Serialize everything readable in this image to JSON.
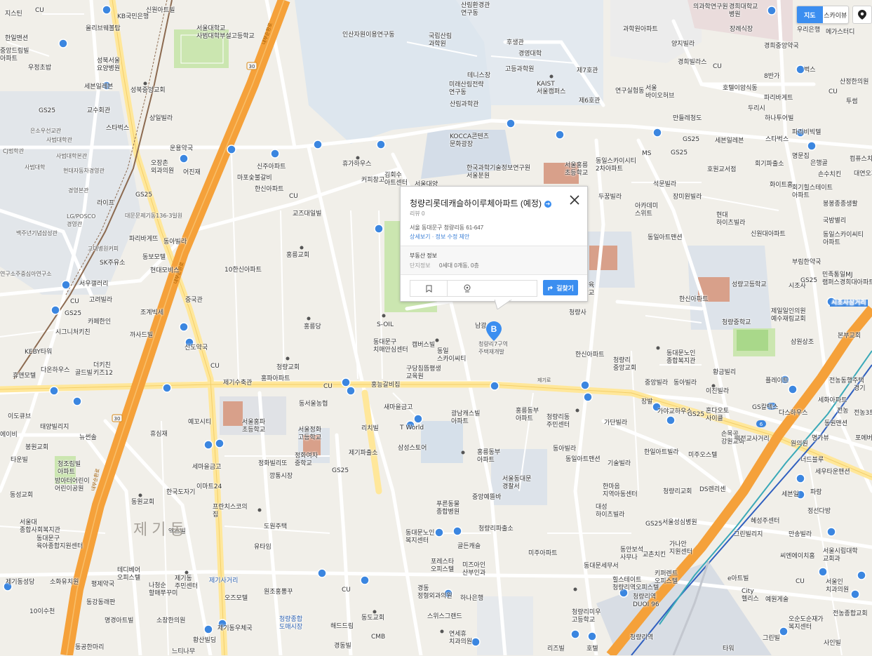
{
  "map_controls": {
    "map_type_map": "지도",
    "map_type_skyview": "스카이뷰",
    "location_icon": "location-icon"
  },
  "popup": {
    "title": "청량리롯데캐슬하이루체아파트 (예정)",
    "review": "리뷰 0",
    "address": "서울 동대문구 청량리동 61-647",
    "link_detail": "상세보기",
    "link_sep": "·",
    "link_edit": "정보 수정 제안",
    "section_title": "부동산 정보",
    "complex_key": "단지정보",
    "complex_value": "0세대 0개동, 0층",
    "route_label": "길찾기",
    "bookmark_icon": "bookmark-icon",
    "place_icon": "map-pin-icon",
    "close_icon": "close-icon",
    "route_icon": "direction-icon"
  },
  "marker": {
    "label": "B",
    "color": "#3b8ef0"
  },
  "map_labels": {
    "district_big": "제기동",
    "road_naebu": "내부순환로",
    "road_30": "30",
    "road_6": "6",
    "road_jegiro": "제기로",
    "jegi_intersection": "제기사거리",
    "jegi_station_label": "제기동역",
    "kaist": "KAIST\n서울캠퍼스",
    "korea_univ_hospital": "경희대학교\n병원",
    "cheongnyangni_market": "청량리종합\n도매시장"
  },
  "colors": {
    "background": "#f1efe9",
    "road_major": "#f59a2a",
    "road_secondary": "#ffe79a",
    "park": "#cbe6b0",
    "water": "#c8d9ea",
    "building": "#c9cfd8",
    "accent": "#3b8ef0"
  }
}
